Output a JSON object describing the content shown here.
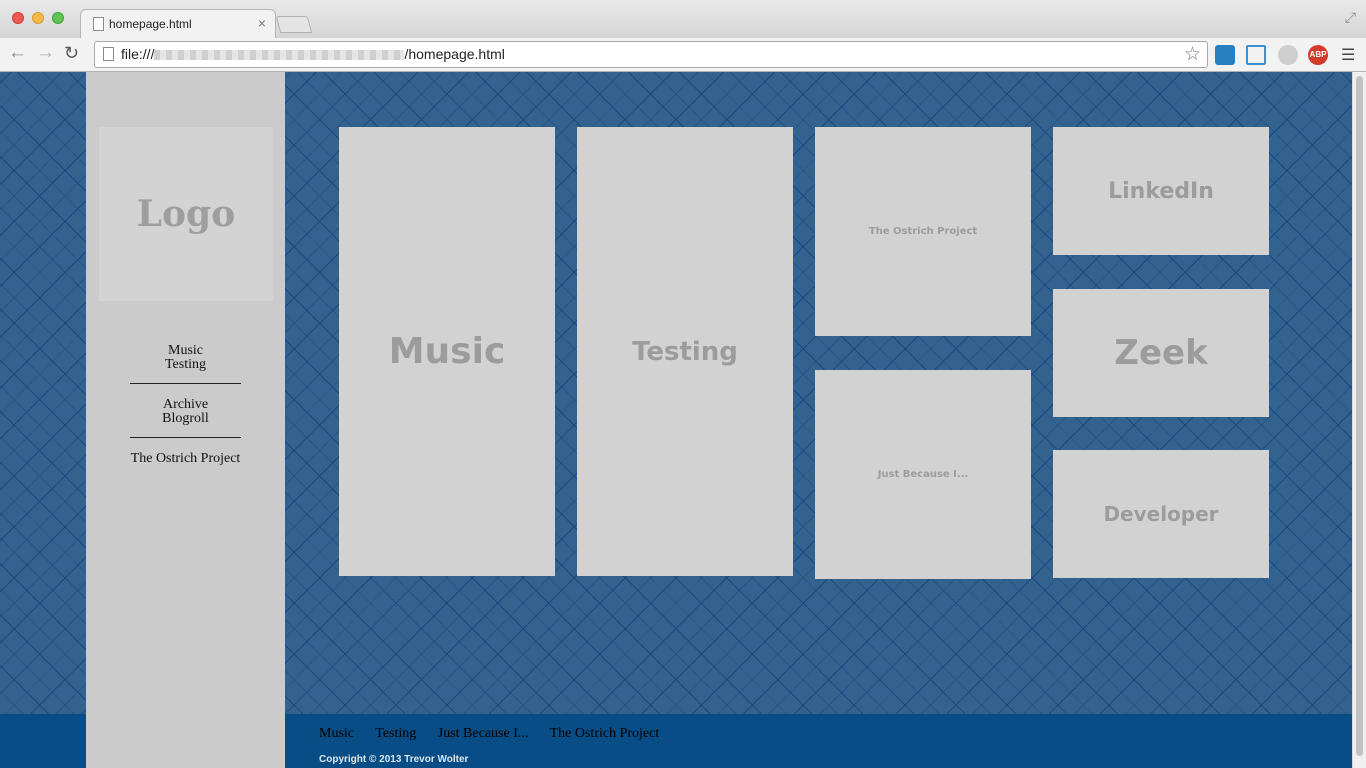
{
  "browser": {
    "tab_title": "homepage.html",
    "tab_close": "×",
    "url_prefix": "file:///",
    "url_suffix": "/homepage.html",
    "abp_label": "ABP"
  },
  "sidebar": {
    "logo": "Logo",
    "groups": [
      [
        "Music",
        "Testing"
      ],
      [
        "Archive",
        "Blogroll"
      ],
      [
        "The Ostrich Project"
      ]
    ]
  },
  "tiles": {
    "music": "Music",
    "testing": "Testing",
    "ostrich": "The Ostrich Project",
    "just_because": "Just Because I...",
    "linkedin": "LinkedIn",
    "zeek": "Zeek",
    "developer": "Developer"
  },
  "footer": {
    "links": [
      "Music",
      "Testing",
      "Just Because I...",
      "The Ostrich Project"
    ],
    "copyright": "Copyright © 2013 Trevor Wolter"
  },
  "colors": {
    "page_background": "#33628f",
    "footer_background": "#084d85",
    "sidebar_background": "#cbcbcb",
    "tile_background": "#d2d2d2",
    "tile_text": "#9c9c9c"
  }
}
